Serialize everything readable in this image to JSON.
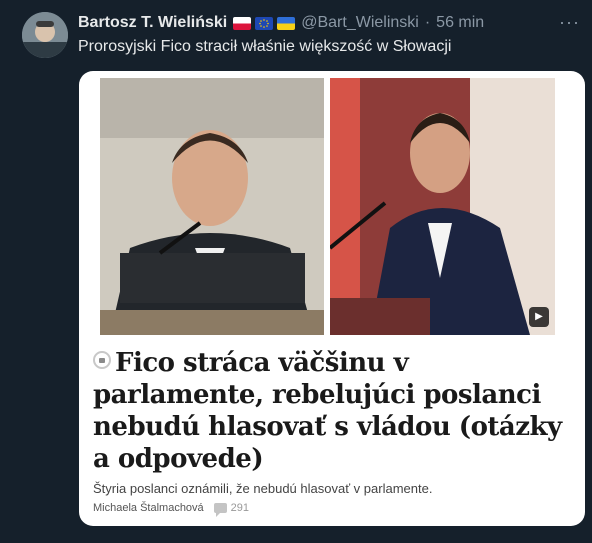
{
  "tweet": {
    "author_name": "Bartosz T. Wieliński",
    "handle": "@Bart_Wielinski",
    "separator": "·",
    "time": "56 min",
    "more_label": "···",
    "text": "Prorosyjski Fico stracił właśnie większość w Słowacji"
  },
  "card": {
    "headline": "Fico stráca väčšinu v parlamente, rebelujúci poslanci nebudú hlasovať s vládou (otázky a odpovede)",
    "lead": "Štyria poslanci oznámili, že nebudú hlasovať v parlamente.",
    "author": "Michaela Štalmachová",
    "comment_count": "291",
    "play_label": "▶"
  },
  "colors": {
    "background": "#15202b",
    "text": "#e7e9ea",
    "muted": "#8b98a5"
  }
}
